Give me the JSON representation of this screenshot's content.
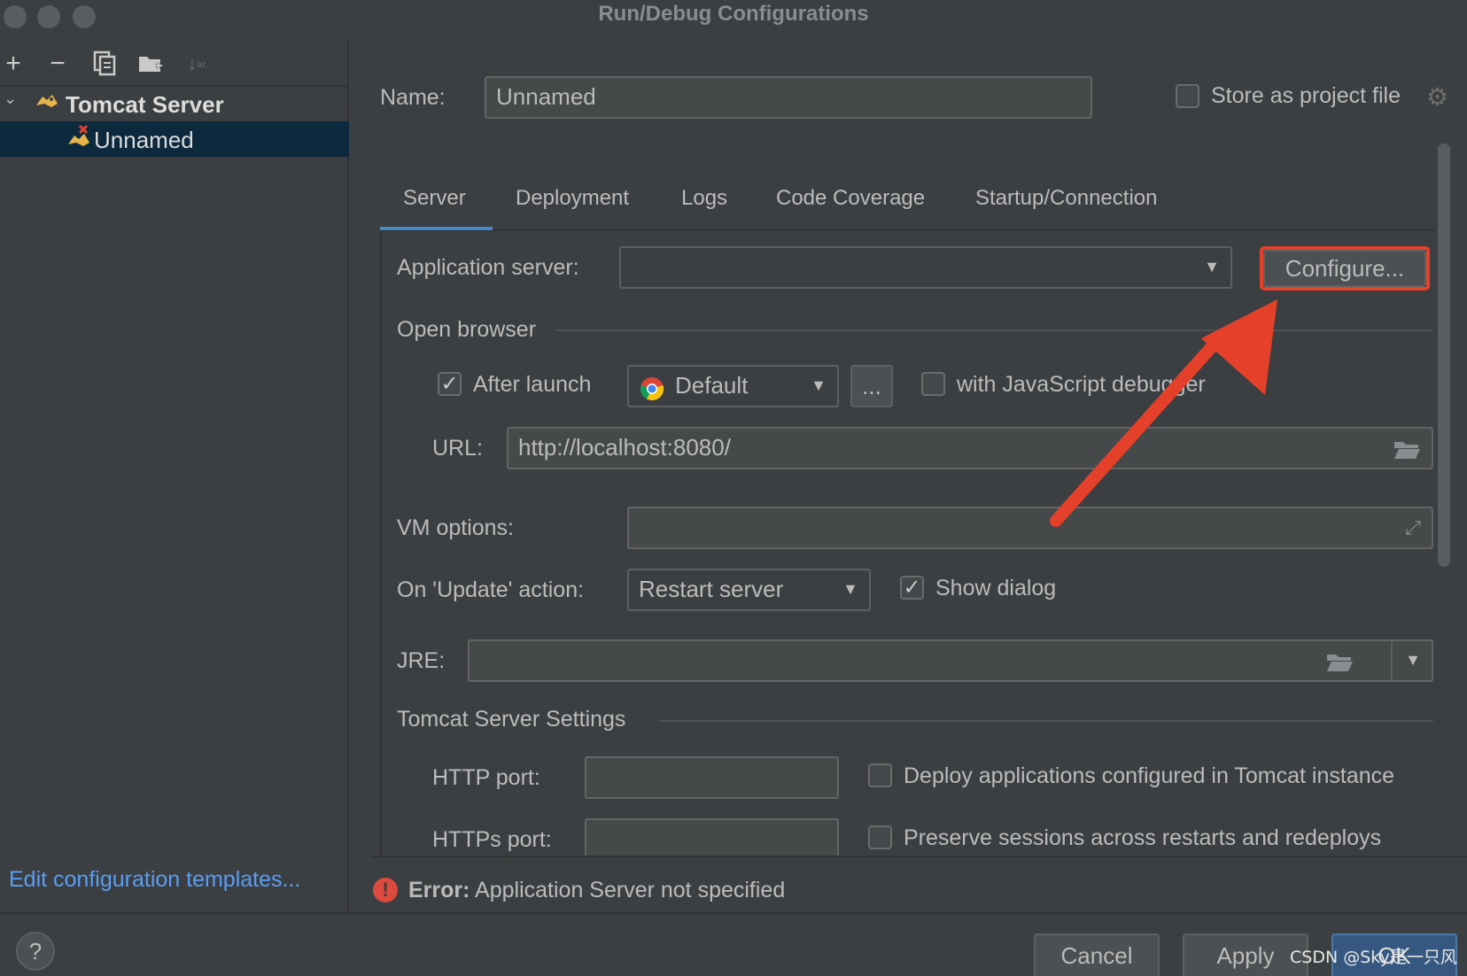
{
  "window": {
    "title": "Run/Debug Configurations"
  },
  "sidebar": {
    "toolbar_icons": [
      "add-icon",
      "remove-icon",
      "copy-icon",
      "folder-add-icon",
      "sort-icon"
    ],
    "tree": {
      "group_label": "Tomcat Server",
      "selected_item": "Unnamed"
    },
    "edit_templates_link": "Edit configuration templates..."
  },
  "header": {
    "name_label": "Name:",
    "name_value": "Unnamed",
    "store_label": "Store as project file",
    "store_checked": false
  },
  "tabs": [
    {
      "label": "Server",
      "active": true
    },
    {
      "label": "Deployment",
      "active": false
    },
    {
      "label": "Logs",
      "active": false
    },
    {
      "label": "Code Coverage",
      "active": false
    },
    {
      "label": "Startup/Connection",
      "active": false
    }
  ],
  "server": {
    "app_server_label": "Application server:",
    "app_server_value": "",
    "configure_button": "Configure...",
    "open_browser_label": "Open browser",
    "after_launch_label": "After launch",
    "after_launch_checked": true,
    "browser_value": "Default",
    "browse_button": "...",
    "js_debugger_label": "with JavaScript debugger",
    "js_debugger_checked": false,
    "url_label": "URL:",
    "url_value": "http://localhost:8080/",
    "vm_options_label": "VM options:",
    "vm_options_value": "",
    "update_action_label": "On 'Update' action:",
    "update_action_value": "Restart server",
    "show_dialog_label": "Show dialog",
    "show_dialog_checked": true,
    "jre_label": "JRE:",
    "jre_value": "",
    "tomcat_settings_label": "Tomcat Server Settings",
    "http_port_label": "HTTP port:",
    "http_port_value": "",
    "deploy_apps_label": "Deploy applications configured in Tomcat instance",
    "deploy_apps_checked": false,
    "https_port_label": "HTTPs port:",
    "https_port_value": "",
    "preserve_sessions_label": "Preserve sessions across restarts and redeploys",
    "preserve_sessions_checked": false
  },
  "status": {
    "error_prefix": "Error:",
    "error_message": "Application Server not specified"
  },
  "footer": {
    "help_button": "?",
    "cancel_button": "Cancel",
    "apply_button": "Apply",
    "ok_button": "OK"
  },
  "watermark": "CSDN @Sky是一只风",
  "colors": {
    "background": "#3c3f41",
    "accent": "#4a88c7",
    "link": "#589df6",
    "highlight": "#e5402a",
    "error": "#db4a3c"
  }
}
